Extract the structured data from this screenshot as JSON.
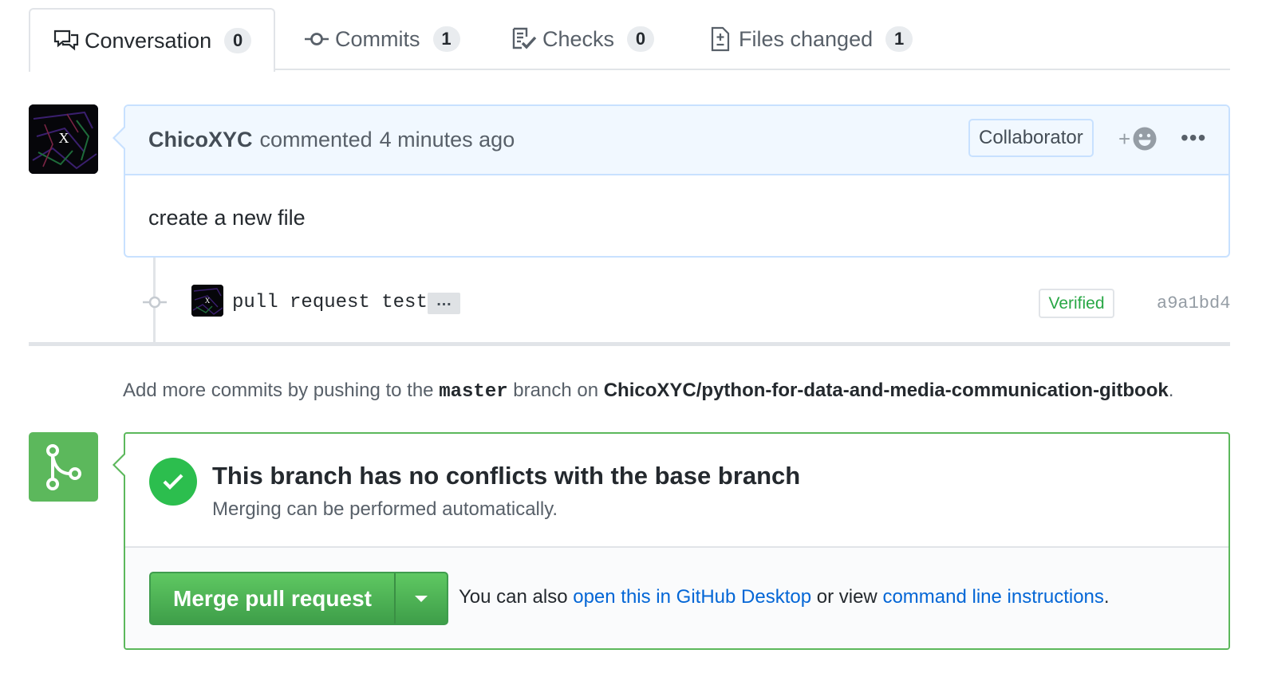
{
  "tabs": [
    {
      "label": "Conversation",
      "count": "0",
      "icon": "comment-discussion-icon",
      "selected": true
    },
    {
      "label": "Commits",
      "count": "1",
      "icon": "git-commit-icon",
      "selected": false
    },
    {
      "label": "Checks",
      "count": "0",
      "icon": "checklist-icon",
      "selected": false
    },
    {
      "label": "Files changed",
      "count": "1",
      "icon": "diff-icon",
      "selected": false
    }
  ],
  "comment": {
    "author": "ChicoXYC",
    "action": "commented",
    "time": "4 minutes ago",
    "role_badge": "Collaborator",
    "reaction_plus": "+",
    "more": "•••",
    "body": "create a new file"
  },
  "avatar": {
    "letter": "X"
  },
  "commit": {
    "message": "pull request test",
    "ellipsis": "…",
    "verified_label": "Verified",
    "sha": "a9a1bd4"
  },
  "push_hint": {
    "prefix": "Add more commits by pushing to the",
    "branch": "master",
    "middle": "branch on",
    "repo": "ChicoXYC/python-for-data-and-media-communication-gitbook",
    "suffix": "."
  },
  "merge": {
    "title": "This branch has no conflicts with the base branch",
    "subtitle": "Merging can be performed automatically.",
    "button_label": "Merge pull request",
    "help_prefix": "You can also",
    "desktop_link": "open this in GitHub Desktop",
    "help_middle": "or view",
    "cli_link": "command line instructions",
    "help_suffix": "."
  },
  "colors": {
    "success_green": "#2cbe4e",
    "merge_button_green": "#5fc862",
    "link_blue": "#0366d6",
    "comment_header_bg": "#f1f8ff",
    "comment_border": "#c8e1ff"
  }
}
